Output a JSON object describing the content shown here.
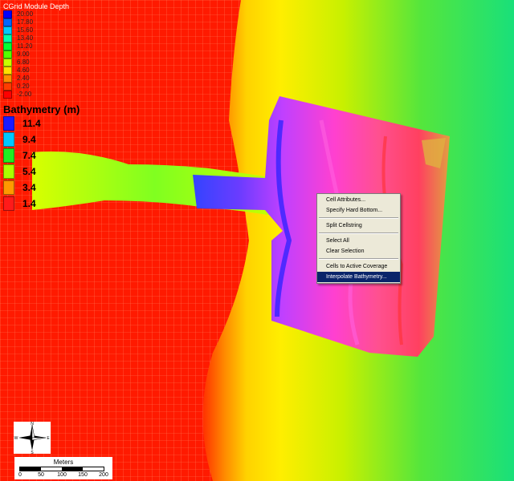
{
  "colors": {
    "ocean": "#ff1a00",
    "land_near": "#ffdd00",
    "land_far": "#19e07a",
    "grid_line": "#ff7a55",
    "menu_bg": "#ece9d8",
    "menu_highlight": "#0a246a"
  },
  "legend_cgrid": {
    "title": "CGrid Module Depth",
    "entries": [
      {
        "label": "20.00",
        "color": "#0000ff"
      },
      {
        "label": "17.80",
        "color": "#0066ff"
      },
      {
        "label": "15.60",
        "color": "#00c8ff"
      },
      {
        "label": "13.40",
        "color": "#00ffaa"
      },
      {
        "label": "11.20",
        "color": "#00ff33"
      },
      {
        "label": "9.00",
        "color": "#55ff00"
      },
      {
        "label": "6.80",
        "color": "#c8ff00"
      },
      {
        "label": "4.60",
        "color": "#ffe000"
      },
      {
        "label": "2.40",
        "color": "#ff8c00"
      },
      {
        "label": "0.20",
        "color": "#ff3c00"
      },
      {
        "label": "-2.00",
        "color": "#ff0000"
      }
    ]
  },
  "legend_bathymetry": {
    "title": "Bathymetry (m)",
    "entries": [
      {
        "label": "11.4",
        "color": "#1a1aff"
      },
      {
        "label": "9.4",
        "color": "#00c8ff"
      },
      {
        "label": "7.4",
        "color": "#22ee22"
      },
      {
        "label": "5.4",
        "color": "#aaff00"
      },
      {
        "label": "3.4",
        "color": "#ff9900"
      },
      {
        "label": "1.4",
        "color": "#ff1a1a"
      }
    ]
  },
  "context_menu": {
    "items": [
      {
        "label": "Cell Attributes...",
        "selected": false
      },
      {
        "label": "Specify Hard Bottom...",
        "selected": false
      },
      {
        "sep": true
      },
      {
        "label": "Split Cellstring",
        "selected": false
      },
      {
        "sep": true
      },
      {
        "label": "Select All",
        "selected": false
      },
      {
        "label": "Clear Selection",
        "selected": false
      },
      {
        "sep": true
      },
      {
        "label": "Cells to Active Coverage",
        "selected": false
      },
      {
        "label": "Interpolate Bathymetry...",
        "selected": true
      }
    ]
  },
  "compass": {
    "n": "N",
    "s": "S",
    "e": "E",
    "w": "W"
  },
  "scale_bar": {
    "title": "Meters",
    "ticks": [
      "0",
      "50",
      "100",
      "150",
      "200"
    ]
  }
}
